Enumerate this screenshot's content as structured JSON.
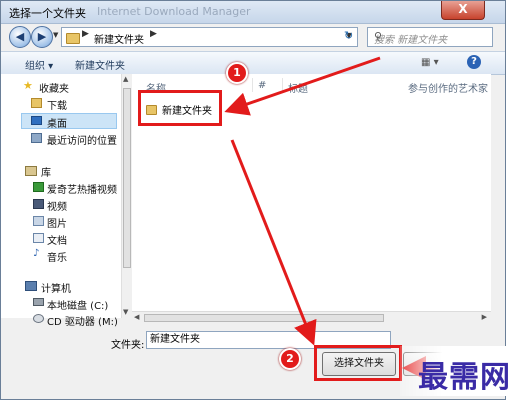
{
  "window": {
    "title": "选择一个文件夹",
    "background_app_title": "Internet Download Manager",
    "close_label": "X"
  },
  "address": {
    "current_folder": "新建文件夹",
    "search_placeholder": "搜索 新建文件夹"
  },
  "toolbar": {
    "organize_label": "组织 ▾",
    "new_folder_label": "新建文件夹",
    "help_label": "?"
  },
  "sidebar": {
    "items": [
      {
        "label": "收藏夹",
        "icon": "star-icon"
      },
      {
        "label": "下载",
        "icon": "download-folder-icon"
      },
      {
        "label": "桌面",
        "icon": "desktop-icon",
        "selected": true
      },
      {
        "label": "最近访问的位置",
        "icon": "recent-places-icon"
      },
      {
        "label": "库",
        "icon": "library-icon"
      },
      {
        "label": "爱奇艺热播视频",
        "icon": "iqiyi-icon"
      },
      {
        "label": "视频",
        "icon": "videos-icon"
      },
      {
        "label": "图片",
        "icon": "pictures-icon"
      },
      {
        "label": "文档",
        "icon": "documents-icon"
      },
      {
        "label": "音乐",
        "icon": "music-icon"
      },
      {
        "label": "计算机",
        "icon": "computer-icon"
      },
      {
        "label": "本地磁盘 (C:)",
        "icon": "drive-icon"
      },
      {
        "label": "CD 驱动器 (M:)",
        "icon": "cd-drive-icon"
      }
    ]
  },
  "file_list": {
    "columns": [
      "名称",
      "#",
      "标题",
      "参与创作的艺术家"
    ],
    "rows": [
      {
        "name": "新建文件夹"
      }
    ]
  },
  "footer": {
    "filename_label": "文件夹:",
    "filename_value": "新建文件夹",
    "select_button_label": "选择文件夹"
  },
  "annotations": {
    "step1": "1",
    "step2": "2",
    "color": "#e21b1b"
  },
  "watermark": {
    "text": "最需网"
  }
}
